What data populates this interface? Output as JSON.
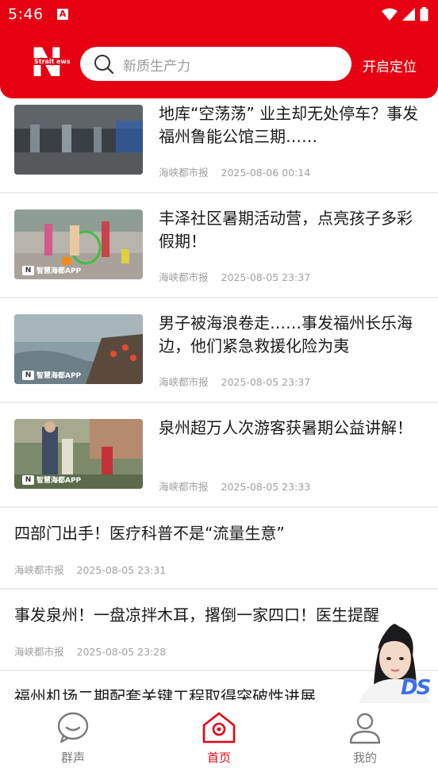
{
  "status_bar": {
    "time": "5:46"
  },
  "header": {
    "logo_letter": "N",
    "logo_text_left": "Strait",
    "logo_text_right": "ews",
    "search_placeholder": "新质生产力",
    "locate_label": "开启定位"
  },
  "news": [
    {
      "title": "地库“空荡荡” 业主却无处停车？事发福州鲁能公馆三期……",
      "source": "海峡都市报",
      "time": "2025-08-06 00:14",
      "has_image": true,
      "watermark": ""
    },
    {
      "title": "丰泽社区暑期活动营，点亮孩子多彩假期！",
      "source": "海峡都市报",
      "time": "2025-08-05 23:37",
      "has_image": true,
      "watermark": "智慧海都APP"
    },
    {
      "title": "男子被海浪卷走……事发福州长乐海边，他们紧急救援化险为夷",
      "source": "海峡都市报",
      "time": "2025-08-05 23:37",
      "has_image": true,
      "watermark": "智慧海都APP"
    },
    {
      "title": "泉州超万人次游客获暑期公益讲解！",
      "source": "海峡都市报",
      "time": "2025-08-05 23:33",
      "has_image": true,
      "watermark": "智慧海都APP"
    },
    {
      "title": "四部门出手！医疗科普不是“流量生意”",
      "source": "海峡都市报",
      "time": "2025-08-05 23:31",
      "has_image": false
    },
    {
      "title": "事发泉州！一盘凉拌木耳，撂倒一家四口！医生提醒",
      "source": "海峡都市报",
      "time": "2025-08-05 23:28",
      "has_image": false
    },
    {
      "title": "福州机场二期配套关键工程取得突破性进展",
      "source": "",
      "time": "",
      "has_image": false
    }
  ],
  "tabbar": [
    {
      "label": "群声",
      "icon": "chat-bubble-icon",
      "active": false
    },
    {
      "label": "首页",
      "icon": "home-icon",
      "active": true
    },
    {
      "label": "我的",
      "icon": "user-icon",
      "active": false
    }
  ],
  "assistant_badge": "DS",
  "colors": {
    "brand": "#e60012",
    "text": "#1a1a1a",
    "meta": "#a0a0a0",
    "tab_inactive": "#7a7a7a"
  }
}
